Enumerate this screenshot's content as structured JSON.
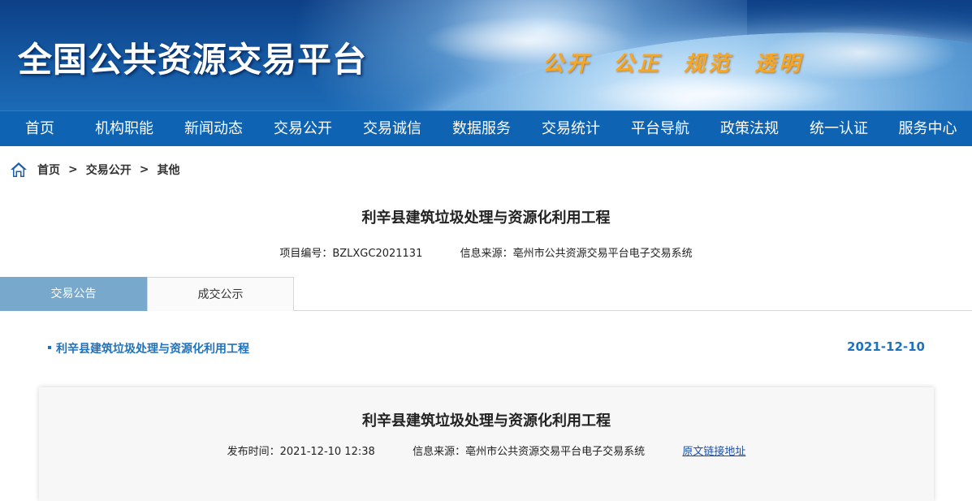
{
  "banner": {
    "title": "全国公共资源交易平台",
    "slogan": "公开 公正 规范 透明"
  },
  "nav": {
    "items": [
      {
        "label": "首页"
      },
      {
        "label": "机构职能"
      },
      {
        "label": "新闻动态"
      },
      {
        "label": "交易公开"
      },
      {
        "label": "交易诚信"
      },
      {
        "label": "数据服务"
      },
      {
        "label": "交易统计"
      },
      {
        "label": "平台导航"
      },
      {
        "label": "政策法规"
      },
      {
        "label": "统一认证"
      },
      {
        "label": "服务中心"
      }
    ]
  },
  "breadcrumb": {
    "icon": "home-icon",
    "items": [
      "首页",
      "交易公开",
      "其他"
    ],
    "separator": ">"
  },
  "project": {
    "title": "利辛县建筑垃圾处理与资源化利用工程",
    "code_label": "项目编号：",
    "code": "BZLXGC2021131",
    "source_label": "信息来源：",
    "source": "亳州市公共资源交易平台电子交易系统"
  },
  "tabs": [
    {
      "label": "交易公告",
      "active": true
    },
    {
      "label": "成交公示",
      "active": false
    }
  ],
  "list": {
    "link": "利辛县建筑垃圾处理与资源化利用工程",
    "date": "2021-12-10"
  },
  "card": {
    "title": "利辛县建筑垃圾处理与资源化利用工程",
    "publish_label": "发布时间：",
    "publish_time": "2021-12-10 12:38",
    "source_label": "信息来源：",
    "source": "亳州市公共资源交易平台电子交易系统",
    "link_label": "原文链接地址"
  },
  "colors": {
    "nav_bg": "#0e64b3",
    "tab_active_bg": "#78a8cc",
    "link": "#1f72bd",
    "slogan": "#f5a623"
  }
}
